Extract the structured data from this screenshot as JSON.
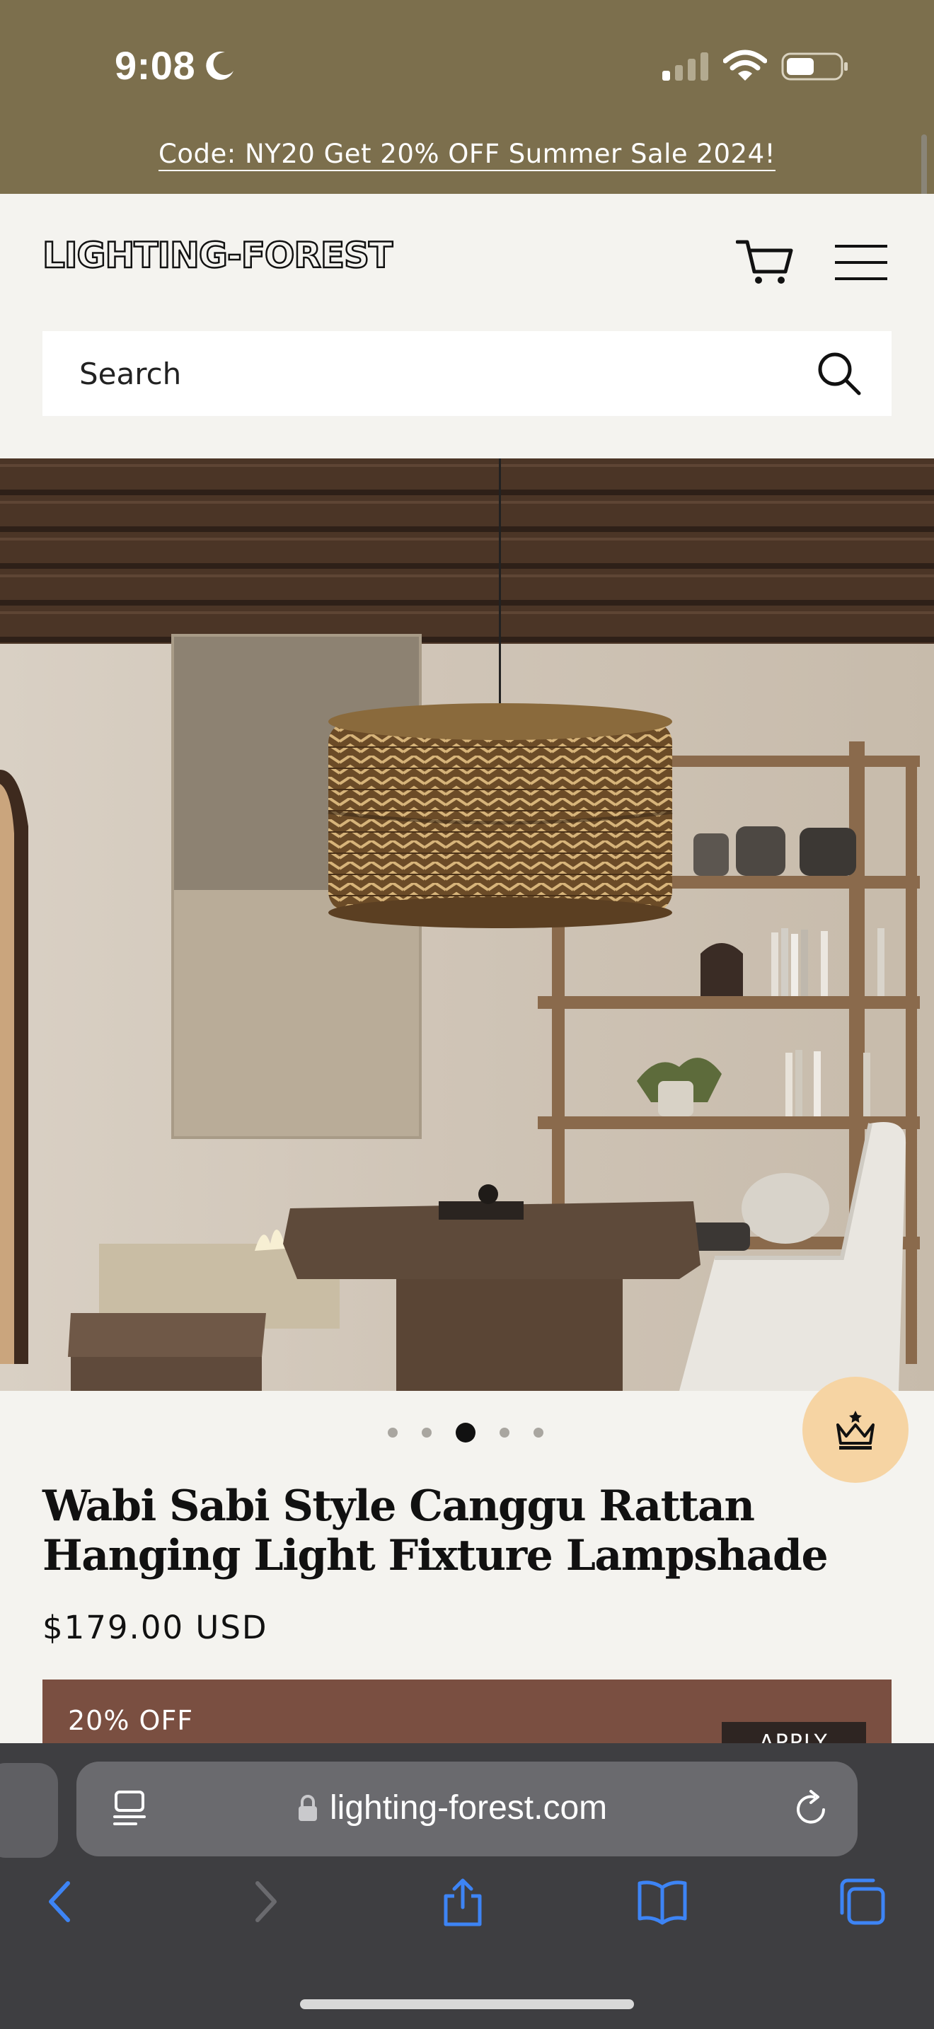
{
  "status_bar": {
    "time": "9:08"
  },
  "announcement": {
    "text": "Code: NY20 Get 20% OFF Summer Sale 2024!"
  },
  "header": {
    "logo": "LIGHTING-FOREST",
    "search_placeholder": "Search"
  },
  "carousel": {
    "total": 5,
    "active": 3
  },
  "product": {
    "title": "Wabi Sabi Style Canggu Rattan Hanging Light Fixture Lampshade",
    "price": "$179.00 USD"
  },
  "promo": {
    "label": "20% OFF",
    "button": "APPLY"
  },
  "browser": {
    "url": "lighting-forest.com"
  },
  "colors": {
    "announcement_bg": "#7c6f4d",
    "page_bg": "#f4f3ef",
    "promo_bg": "#7a4f41",
    "crown_bg": "#f6d4a3",
    "browser_bg": "#3e3e41",
    "toolbar_blue": "#3d84f5"
  }
}
